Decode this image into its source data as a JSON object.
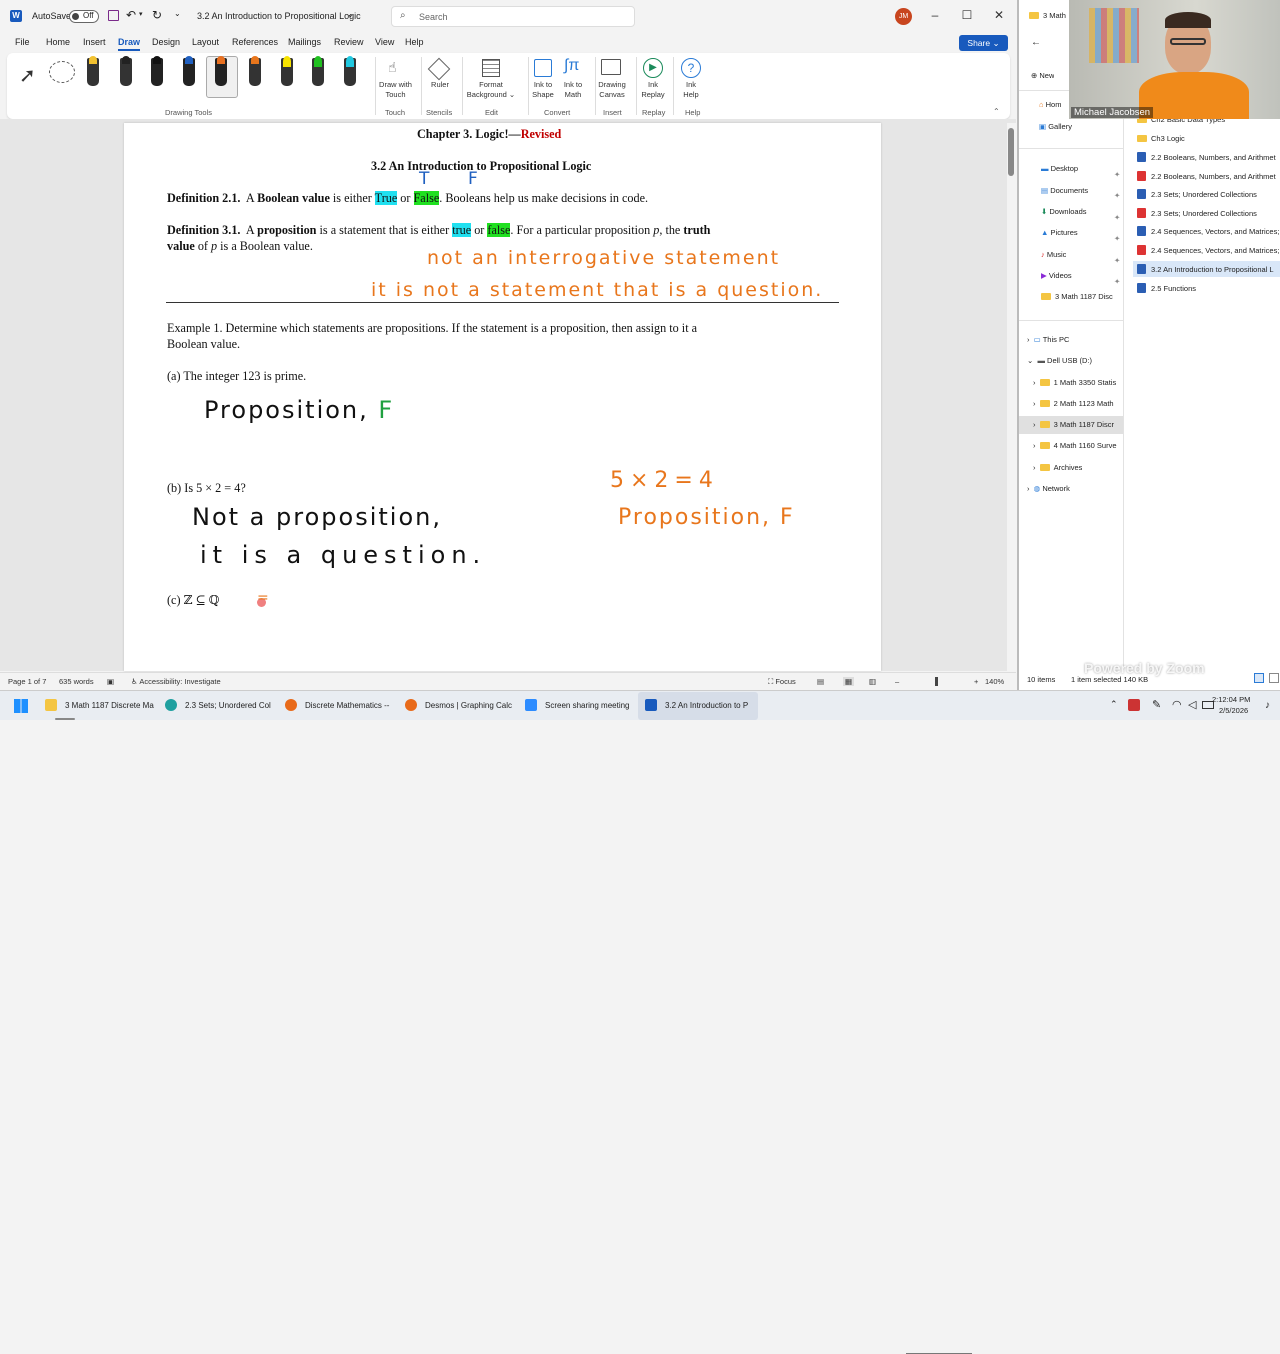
{
  "word": {
    "autosave_label": "AutoSave",
    "autosave_state": "Off",
    "doc_title": "3.2 An Introduction to Propositional Logic",
    "search_placeholder": "Search",
    "avatar_initials": "JM",
    "tabs": [
      "File",
      "Home",
      "Insert",
      "Draw",
      "Design",
      "Layout",
      "References",
      "Mailings",
      "Review",
      "View",
      "Help"
    ],
    "active_tab": "Draw",
    "share_label": "Share",
    "ribbon": {
      "tools": [
        {
          "line1": "Draw with",
          "line2": "Touch"
        },
        {
          "line1": "Ruler",
          "line2": ""
        },
        {
          "line1": "Format",
          "line2": "Background"
        },
        {
          "line1": "Ink to",
          "line2": "Shape"
        },
        {
          "line1": "Ink to",
          "line2": "Math"
        },
        {
          "line1": "Drawing",
          "line2": "Canvas"
        },
        {
          "line1": "Ink",
          "line2": "Replay"
        },
        {
          "line1": "Ink",
          "line2": "Help"
        }
      ],
      "groups": [
        "Drawing Tools",
        "Touch",
        "Stencils",
        "Edit",
        "Convert",
        "Insert",
        "Replay",
        "Help"
      ],
      "pen_colors": [
        "#f2c230",
        "#222222",
        "#111111",
        "#2060c0",
        "#e87020",
        "#e8761c",
        "#f7e300",
        "#20c020",
        "#20c8e0"
      ]
    },
    "status": {
      "page": "Page 1 of 7",
      "words": "635 words",
      "accessibility": "Accessibility: Investigate",
      "focus": "Focus",
      "zoom": "140%"
    }
  },
  "document": {
    "chapter_prefix": "Chapter 3.  Logic!—",
    "chapter_revised": "Revised",
    "section_title": "3.2 An Introduction to Propositional Logic",
    "def21": {
      "label": "Definition 2.1.",
      "a": "A",
      "term": "Boolean value",
      "mid": "is either",
      "true": "True",
      "or": "or",
      "false": "False",
      "rest": ".  Booleans help us make decisions in code."
    },
    "def31": {
      "label": "Definition 3.1.",
      "a": "A",
      "term": "proposition",
      "mid": "is a statement that is either",
      "true": "true",
      "or": "or",
      "false": "false",
      "rest": ".  For a particular proposition",
      "p": "p",
      "comma": ", the",
      "truth": "truth",
      "value": "value",
      "of": "of",
      "p2": "p",
      "end": "is a Boolean value."
    },
    "example_line1": "Example 1.  Determine which statements are propositions.  If the statement is a proposition, then assign to it a",
    "example_line2": "Boolean value.",
    "item_a": "(a)  The integer 123 is prime.",
    "item_b": "(b)  Is 5 × 2 = 4?",
    "item_c": "(c)  ℤ ⊆ ℚ"
  },
  "ink": {
    "t_mark": "T",
    "f_mark": "F",
    "note1": "not an interrogative statement",
    "note2": "it is not a statement that is a question.",
    "a_answer": "Proposition,",
    "a_value": "F",
    "b_answer1": "Not a proposition,",
    "b_answer2": "it is a question.",
    "side_eq": "5×2=4",
    "side_answer": "Proposition, F",
    "c_mark": "="
  },
  "explorer": {
    "title": "3 Math",
    "new_label": "New",
    "home": "Hom",
    "gallery": "Gallery",
    "quick": [
      "Desktop",
      "Documents",
      "Downloads",
      "Pictures",
      "Music",
      "Videos",
      "3 Math 1187 Disc"
    ],
    "tree": [
      "This PC",
      "Dell USB (D:)",
      "1 Math 3350 Statis",
      "2 Math 1123 Math",
      "3 Math 1187 Discr",
      "4 Math 1160 Surve",
      "Archives",
      "Network"
    ],
    "files": [
      {
        "name": "Ch2 Basic Data Types",
        "type": "folder"
      },
      {
        "name": "Ch3 Logic",
        "type": "folder"
      },
      {
        "name": "2.2 Booleans, Numbers, and Arithmet",
        "type": "doc"
      },
      {
        "name": "2.2 Booleans, Numbers, and Arithmet",
        "type": "pdf"
      },
      {
        "name": "2.3 Sets; Unordered Collections",
        "type": "doc"
      },
      {
        "name": "2.3 Sets; Unordered Collections",
        "type": "pdf"
      },
      {
        "name": "2.4 Sequences, Vectors, and Matrices;",
        "type": "doc"
      },
      {
        "name": "2.4 Sequences, Vectors, and Matrices;",
        "type": "pdf"
      },
      {
        "name": "3.2 An Introduction to Propositional L",
        "type": "doc"
      },
      {
        "name": "2.5 Functions",
        "type": "doc"
      }
    ],
    "status_items": "10 items",
    "status_selected": "1 item selected  140 KB"
  },
  "webcam": {
    "name": "Michael Jacobsen",
    "watermark": "Powered by Zoom"
  },
  "taskbar": {
    "apps": [
      "3 Math 1187 Discrete Ma",
      "2.3 Sets; Unordered Col",
      "Discrete Mathematics --",
      "Desmos | Graphing Calc",
      "Screen sharing meeting",
      "3.2 An Introduction to P"
    ],
    "time": "2:12:04 PM",
    "date": "2/5/2026"
  }
}
